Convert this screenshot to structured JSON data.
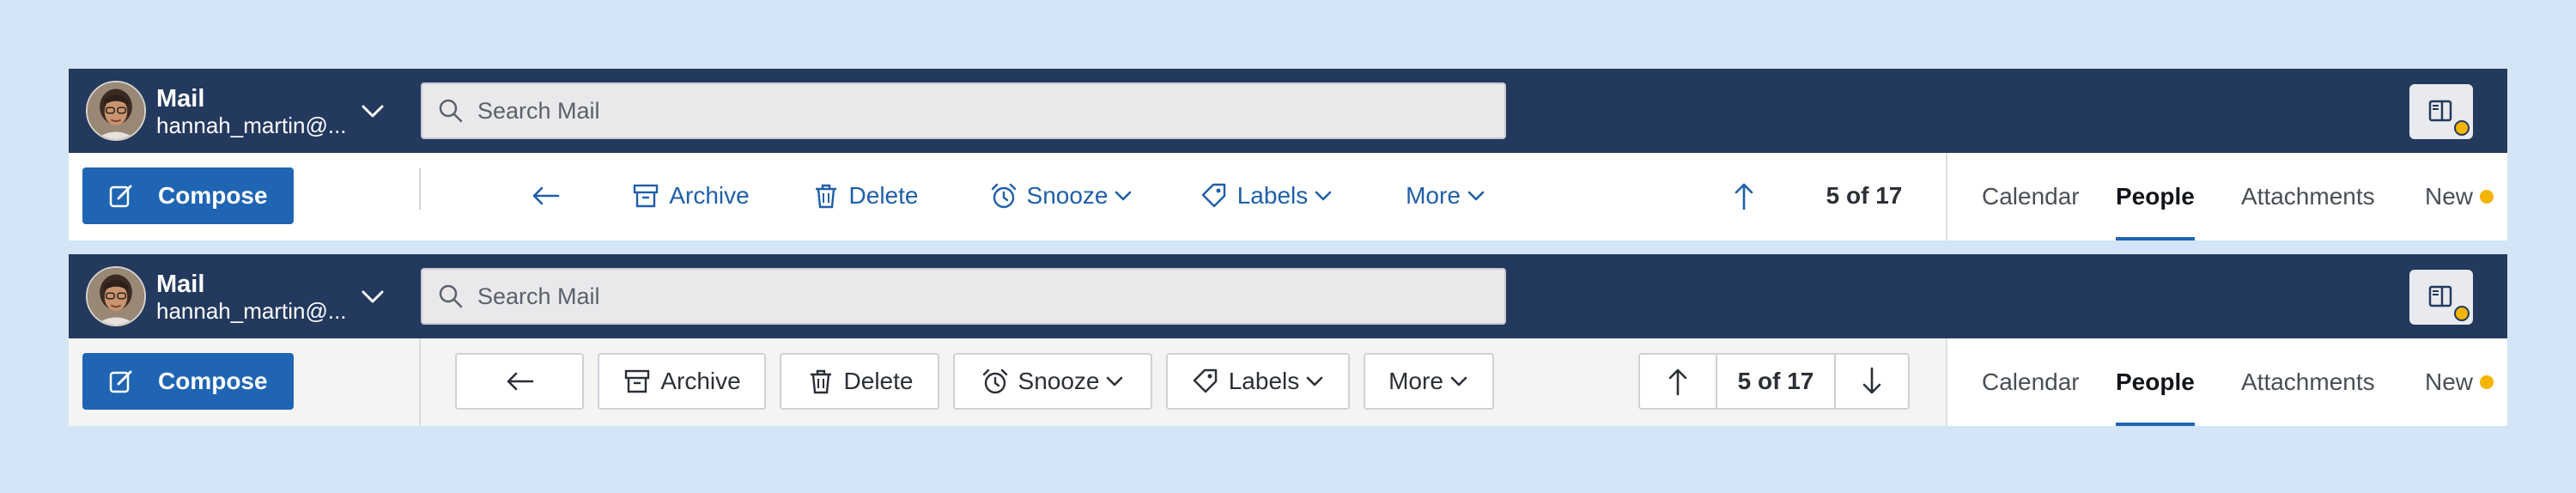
{
  "header": {
    "app_name": "Mail",
    "account": "hannah_martin@...",
    "search_placeholder": "Search Mail"
  },
  "actions": {
    "compose": "Compose",
    "archive": "Archive",
    "delete": "Delete",
    "snooze": "Snooze",
    "labels": "Labels",
    "more": "More"
  },
  "pagination": {
    "position": "5 of 17"
  },
  "tabs": [
    {
      "label": "Calendar",
      "active": false
    },
    {
      "label": "People",
      "active": true
    },
    {
      "label": "Attachments",
      "active": false
    },
    {
      "label": "New",
      "active": false,
      "badge": true
    }
  ],
  "colors": {
    "header_bg": "#23395d",
    "accent": "#1f65b3",
    "notification": "#f5b400",
    "page_bg": "#d3e5f6"
  },
  "variants": [
    "text-style toolbar",
    "button-style toolbar"
  ]
}
